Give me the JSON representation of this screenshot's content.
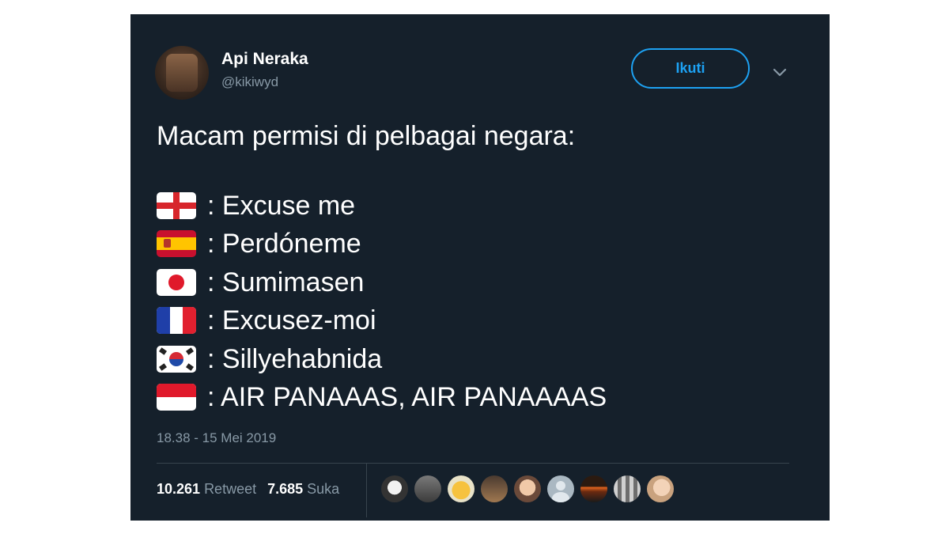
{
  "user": {
    "name": "Api Neraka",
    "handle": "@kikiwyd"
  },
  "follow_label": "Ikuti",
  "tweet": {
    "intro": "Macam permisi di pelbagai negara:",
    "lines": [
      {
        "flag": "england-flag-icon",
        "text": ": Excuse me"
      },
      {
        "flag": "spain-flag-icon",
        "text": ": Perdóneme"
      },
      {
        "flag": "japan-flag-icon",
        "text": ": Sumimasen"
      },
      {
        "flag": "france-flag-icon",
        "text": ": Excusez-moi"
      },
      {
        "flag": "south-korea-flag-icon",
        "text": ": Sillyehabnida"
      },
      {
        "flag": "indonesia-flag-icon",
        "text": ": AIR PANAAAS, AIR PANAAAAS"
      }
    ],
    "timestamp": "18.38 - 15 Mei 2019"
  },
  "stats": {
    "retweet_count": "10.261",
    "retweet_label": "Retweet",
    "like_count": "7.685",
    "like_label": "Suka"
  },
  "colors": {
    "background": "#15202b",
    "accent": "#1da1f2",
    "muted": "#8899a6",
    "divider": "#38444d"
  }
}
